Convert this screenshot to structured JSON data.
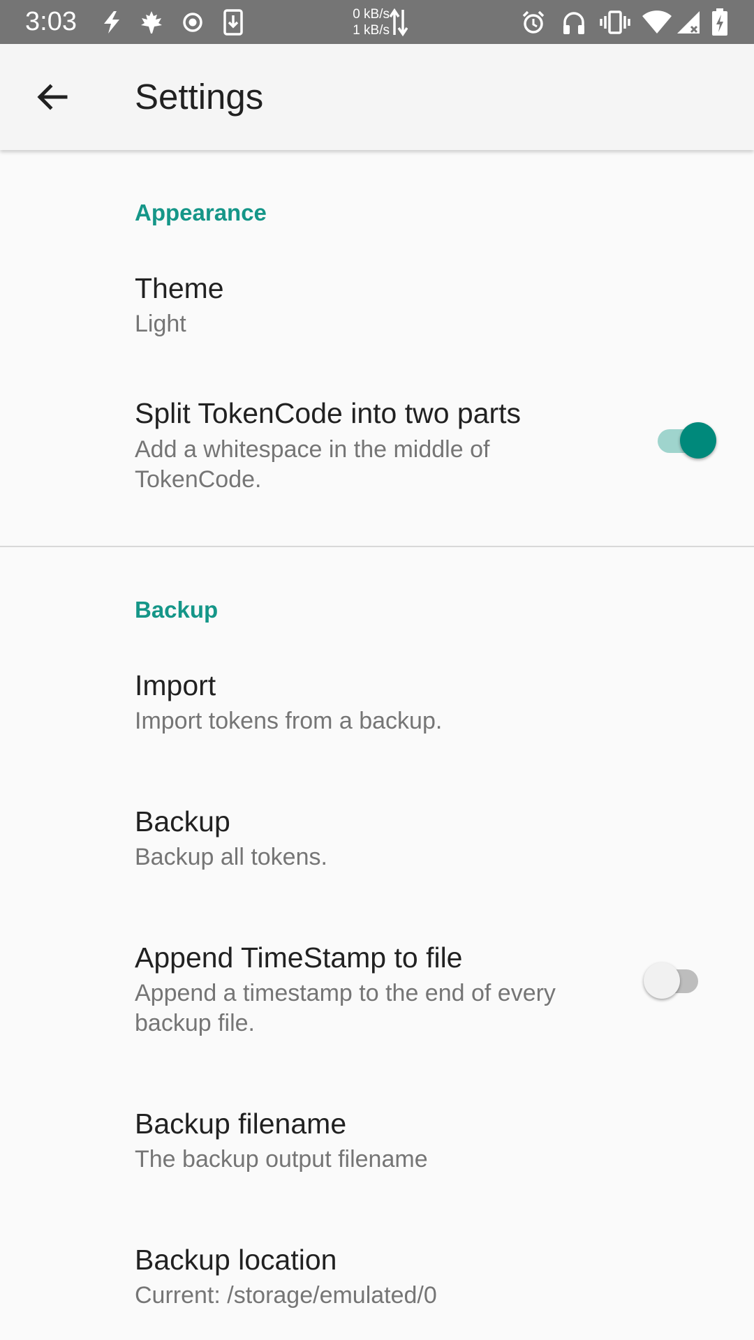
{
  "status_bar": {
    "time": "3:03",
    "net_up": "0 kB/s",
    "net_down": "1 kB/s",
    "icons_left": [
      "bolt-icon",
      "maple-leaf-icon",
      "record-icon",
      "download-icon"
    ],
    "icons_right": [
      "alarm-icon",
      "headphones-icon",
      "vibrate-icon",
      "wifi-icon",
      "signal-icon",
      "battery-icon"
    ]
  },
  "app_bar": {
    "title": "Settings",
    "back_icon": "arrow-back-icon"
  },
  "colors": {
    "accent": "#159688",
    "switch_thumb_on": "#00897b",
    "status_bar": "#757575"
  },
  "sections": {
    "appearance": {
      "title": "Appearance",
      "theme": {
        "title": "Theme",
        "summary": "Light"
      },
      "split": {
        "title": "Split TokenCode into two parts",
        "summary": "Add a whitespace in the middle of TokenCode.",
        "enabled": true
      }
    },
    "backup": {
      "title": "Backup",
      "import": {
        "title": "Import",
        "summary": "Import tokens from a backup."
      },
      "backup": {
        "title": "Backup",
        "summary": "Backup all tokens."
      },
      "timestamp": {
        "title": "Append TimeStamp to file",
        "summary": "Append a timestamp to the end of every backup file.",
        "enabled": false
      },
      "filename": {
        "title": "Backup filename",
        "summary": "The backup output filename"
      },
      "location": {
        "title": "Backup location",
        "summary": "Current: /storage/emulated/0"
      }
    }
  }
}
